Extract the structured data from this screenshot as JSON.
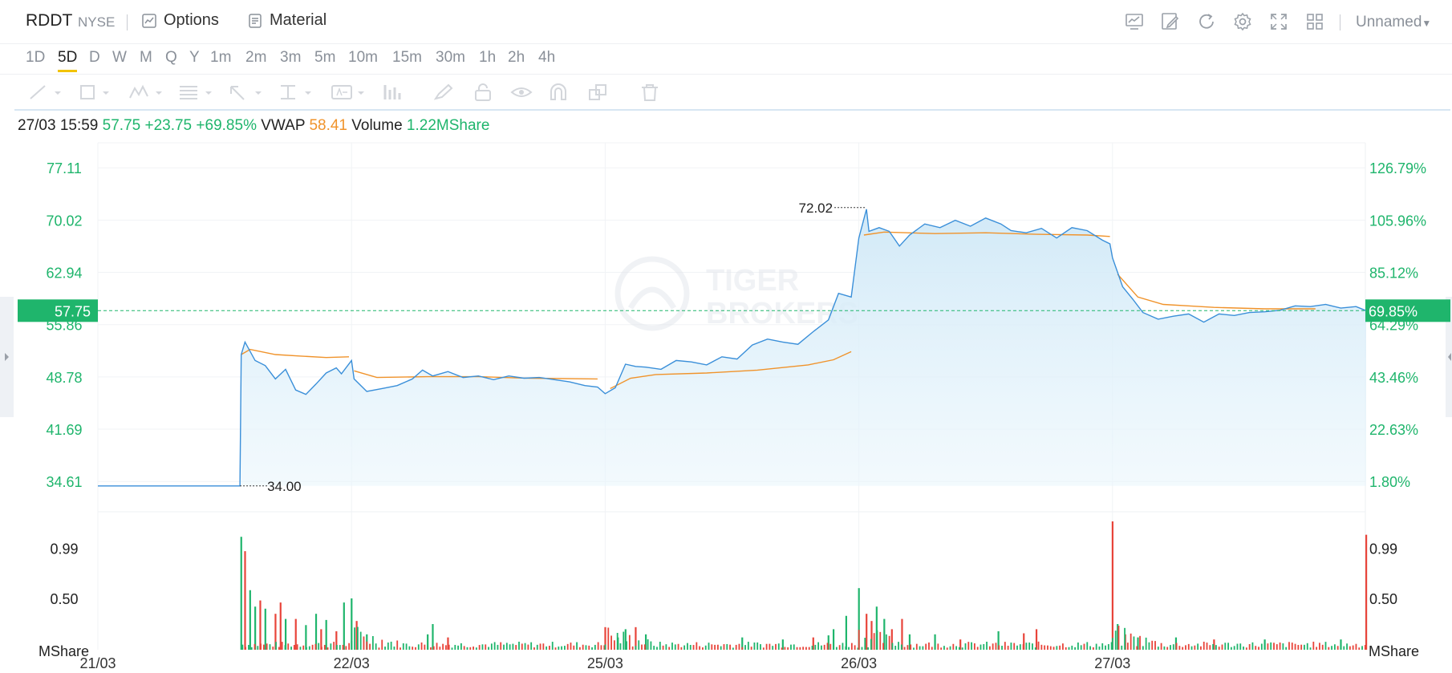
{
  "header": {
    "symbol": "RDDT",
    "exchange": "NYSE",
    "options_label": "Options",
    "material_label": "Material",
    "layout_name": "Unnamed"
  },
  "timeframes": [
    "1D",
    "5D",
    "D",
    "W",
    "M",
    "Q",
    "Y",
    "1m",
    "2m",
    "3m",
    "5m",
    "10m",
    "15m",
    "30m",
    "1h",
    "2h",
    "4h"
  ],
  "active_timeframe": "5D",
  "info": {
    "datetime": "27/03 15:59",
    "price": "57.75",
    "change": "+23.75",
    "change_pct": "+69.85%",
    "vwap_label": "VWAP",
    "vwap_value": "58.41",
    "volume_label": "Volume",
    "volume_value": "1.22MShare"
  },
  "watermark": {
    "line1": "TIGER",
    "line2": "BROKERS"
  },
  "colors": {
    "up": "#1fb56c",
    "down": "#e8443a",
    "price_line": "#3a8fd9",
    "vwap_line": "#f0932b",
    "accent": "#f2c300"
  },
  "chart_data": {
    "type": "line",
    "x_ticks": [
      "21/03",
      "22/03",
      "25/03",
      "26/03",
      "27/03"
    ],
    "left_axis": [
      "77.11",
      "70.02",
      "62.94",
      "55.86",
      "48.78",
      "41.69",
      "34.61"
    ],
    "right_axis": [
      "126.79%",
      "105.96%",
      "85.12%",
      "64.29%",
      "43.46%",
      "22.63%",
      "1.80%"
    ],
    "current_price_tag": "57.75",
    "current_pct_tag": "69.85%",
    "high_label": "72.02",
    "low_label": "34.00",
    "ylim": [
      30.5,
      80.5
    ],
    "prev_close": 34.0,
    "volume_axis": [
      "0.99",
      "0.50"
    ],
    "volume_unit": "MShare",
    "volume_ylim": [
      0,
      1.25
    ],
    "series": [
      {
        "name": "Price",
        "values": [
          [
            0,
            34.0
          ],
          [
            0.56,
            34.0
          ],
          [
            0.565,
            51.8
          ],
          [
            0.58,
            53.5
          ],
          [
            0.62,
            51.0
          ],
          [
            0.66,
            50.3
          ],
          [
            0.7,
            48.5
          ],
          [
            0.74,
            49.8
          ],
          [
            0.78,
            47.0
          ],
          [
            0.82,
            46.4
          ],
          [
            0.86,
            47.8
          ],
          [
            0.9,
            49.3
          ],
          [
            0.94,
            50.0
          ],
          [
            0.96,
            49.2
          ],
          [
            1.0,
            51.0
          ],
          [
            1.01,
            48.5
          ],
          [
            1.06,
            46.8
          ],
          [
            1.12,
            47.2
          ],
          [
            1.18,
            47.6
          ],
          [
            1.24,
            48.5
          ],
          [
            1.28,
            49.7
          ],
          [
            1.32,
            48.9
          ],
          [
            1.38,
            49.5
          ],
          [
            1.44,
            48.7
          ],
          [
            1.5,
            48.9
          ],
          [
            1.56,
            48.4
          ],
          [
            1.62,
            48.9
          ],
          [
            1.68,
            48.6
          ],
          [
            1.74,
            48.7
          ],
          [
            1.8,
            48.4
          ],
          [
            1.86,
            48.1
          ],
          [
            1.92,
            47.6
          ],
          [
            1.97,
            47.4
          ],
          [
            2.0,
            46.5
          ],
          [
            2.04,
            47.3
          ],
          [
            2.08,
            50.5
          ],
          [
            2.12,
            50.2
          ],
          [
            2.16,
            50.1
          ],
          [
            2.22,
            49.8
          ],
          [
            2.28,
            51.0
          ],
          [
            2.34,
            50.8
          ],
          [
            2.4,
            50.4
          ],
          [
            2.46,
            51.5
          ],
          [
            2.52,
            51.2
          ],
          [
            2.58,
            53.1
          ],
          [
            2.64,
            53.9
          ],
          [
            2.7,
            53.5
          ],
          [
            2.76,
            53.2
          ],
          [
            2.82,
            54.9
          ],
          [
            2.88,
            56.5
          ],
          [
            2.92,
            60.1
          ],
          [
            2.97,
            59.6
          ],
          [
            3.0,
            67.6
          ],
          [
            3.03,
            71.5
          ],
          [
            3.04,
            68.5
          ],
          [
            3.08,
            69.0
          ],
          [
            3.12,
            68.5
          ],
          [
            3.16,
            66.5
          ],
          [
            3.2,
            68.0
          ],
          [
            3.26,
            69.5
          ],
          [
            3.32,
            69.0
          ],
          [
            3.38,
            70.0
          ],
          [
            3.44,
            69.2
          ],
          [
            3.5,
            70.3
          ],
          [
            3.56,
            69.5
          ],
          [
            3.6,
            68.6
          ],
          [
            3.66,
            68.3
          ],
          [
            3.72,
            68.9
          ],
          [
            3.78,
            67.6
          ],
          [
            3.84,
            69.0
          ],
          [
            3.9,
            68.6
          ],
          [
            3.96,
            67.3
          ],
          [
            3.99,
            66.8
          ],
          [
            4.0,
            64.9
          ],
          [
            4.04,
            61.0
          ],
          [
            4.08,
            59.3
          ],
          [
            4.12,
            57.5
          ],
          [
            4.18,
            56.6
          ],
          [
            4.24,
            57.0
          ],
          [
            4.3,
            57.3
          ],
          [
            4.36,
            56.2
          ],
          [
            4.42,
            57.3
          ],
          [
            4.48,
            57.1
          ],
          [
            4.54,
            57.5
          ],
          [
            4.6,
            57.6
          ],
          [
            4.66,
            57.8
          ],
          [
            4.72,
            58.4
          ],
          [
            4.78,
            58.3
          ],
          [
            4.84,
            58.6
          ],
          [
            4.9,
            58.1
          ],
          [
            4.96,
            58.3
          ],
          [
            5.0,
            57.75
          ]
        ]
      },
      {
        "name": "VWAP",
        "values": [
          [
            0.565,
            51.8
          ],
          [
            0.6,
            52.5
          ],
          [
            0.7,
            51.8
          ],
          [
            0.8,
            51.6
          ],
          [
            0.9,
            51.4
          ],
          [
            0.99,
            51.5
          ],
          [
            1.01,
            49.6
          ],
          [
            1.1,
            48.7
          ],
          [
            1.3,
            48.8
          ],
          [
            1.5,
            48.8
          ],
          [
            1.7,
            48.6
          ],
          [
            1.97,
            48.5
          ],
          [
            2.02,
            47.2
          ],
          [
            2.1,
            48.6
          ],
          [
            2.2,
            49.1
          ],
          [
            2.4,
            49.3
          ],
          [
            2.6,
            49.7
          ],
          [
            2.8,
            50.4
          ],
          [
            2.9,
            51.1
          ],
          [
            2.97,
            52.2
          ],
          [
            3.02,
            68.0
          ],
          [
            3.1,
            68.4
          ],
          [
            3.3,
            68.2
          ],
          [
            3.5,
            68.3
          ],
          [
            3.7,
            68.1
          ],
          [
            3.9,
            68.0
          ],
          [
            3.99,
            67.8
          ],
          [
            4.02,
            62.7
          ],
          [
            4.1,
            59.6
          ],
          [
            4.2,
            58.6
          ],
          [
            4.4,
            58.2
          ],
          [
            4.6,
            58.0
          ],
          [
            4.8,
            58.0
          ],
          [
            5.0,
            58.2
          ]
        ]
      }
    ],
    "volume_spikes": [
      {
        "x": 0.565,
        "v": 1.1,
        "dir": "up"
      },
      {
        "x": 0.58,
        "v": 0.96,
        "dir": "down"
      },
      {
        "x": 0.6,
        "v": 0.58,
        "dir": "up"
      },
      {
        "x": 0.62,
        "v": 0.42,
        "dir": "up"
      },
      {
        "x": 0.64,
        "v": 0.48,
        "dir": "down"
      },
      {
        "x": 0.66,
        "v": 0.4,
        "dir": "up"
      },
      {
        "x": 0.7,
        "v": 0.35,
        "dir": "down"
      },
      {
        "x": 0.72,
        "v": 0.46,
        "dir": "down"
      },
      {
        "x": 0.74,
        "v": 0.3,
        "dir": "up"
      },
      {
        "x": 0.78,
        "v": 0.3,
        "dir": "down"
      },
      {
        "x": 0.82,
        "v": 0.24,
        "dir": "up"
      },
      {
        "x": 0.86,
        "v": 0.35,
        "dir": "up"
      },
      {
        "x": 0.88,
        "v": 0.2,
        "dir": "down"
      },
      {
        "x": 0.9,
        "v": 0.29,
        "dir": "up"
      },
      {
        "x": 0.94,
        "v": 0.18,
        "dir": "down"
      },
      {
        "x": 0.97,
        "v": 0.46,
        "dir": "up"
      },
      {
        "x": 1.0,
        "v": 0.5,
        "dir": "up"
      },
      {
        "x": 1.02,
        "v": 0.28,
        "dir": "down"
      },
      {
        "x": 1.06,
        "v": 0.15,
        "dir": "up"
      },
      {
        "x": 1.3,
        "v": 0.15,
        "dir": "up"
      },
      {
        "x": 1.32,
        "v": 0.25,
        "dir": "up"
      },
      {
        "x": 1.38,
        "v": 0.12,
        "dir": "down"
      },
      {
        "x": 2.0,
        "v": 0.22,
        "dir": "down"
      },
      {
        "x": 2.05,
        "v": 0.12,
        "dir": "up"
      },
      {
        "x": 2.08,
        "v": 0.2,
        "dir": "up"
      },
      {
        "x": 2.12,
        "v": 0.22,
        "dir": "down"
      },
      {
        "x": 2.16,
        "v": 0.15,
        "dir": "up"
      },
      {
        "x": 2.54,
        "v": 0.12,
        "dir": "up"
      },
      {
        "x": 2.7,
        "v": 0.1,
        "dir": "up"
      },
      {
        "x": 2.82,
        "v": 0.12,
        "dir": "down"
      },
      {
        "x": 2.88,
        "v": 0.14,
        "dir": "up"
      },
      {
        "x": 2.9,
        "v": 0.2,
        "dir": "up"
      },
      {
        "x": 2.95,
        "v": 0.33,
        "dir": "up"
      },
      {
        "x": 3.0,
        "v": 0.6,
        "dir": "up"
      },
      {
        "x": 3.03,
        "v": 0.35,
        "dir": "down"
      },
      {
        "x": 3.05,
        "v": 0.28,
        "dir": "down"
      },
      {
        "x": 3.07,
        "v": 0.42,
        "dir": "up"
      },
      {
        "x": 3.1,
        "v": 0.3,
        "dir": "up"
      },
      {
        "x": 3.13,
        "v": 0.2,
        "dir": "down"
      },
      {
        "x": 3.17,
        "v": 0.3,
        "dir": "down"
      },
      {
        "x": 3.2,
        "v": 0.15,
        "dir": "up"
      },
      {
        "x": 3.3,
        "v": 0.15,
        "dir": "up"
      },
      {
        "x": 3.4,
        "v": 0.1,
        "dir": "down"
      },
      {
        "x": 3.55,
        "v": 0.18,
        "dir": "up"
      },
      {
        "x": 3.65,
        "v": 0.16,
        "dir": "down"
      },
      {
        "x": 3.7,
        "v": 0.2,
        "dir": "down"
      },
      {
        "x": 4.0,
        "v": 1.25,
        "dir": "down"
      },
      {
        "x": 4.02,
        "v": 0.25,
        "dir": "up"
      },
      {
        "x": 4.05,
        "v": 0.15,
        "dir": "down"
      },
      {
        "x": 4.1,
        "v": 0.12,
        "dir": "up"
      },
      {
        "x": 4.25,
        "v": 0.12,
        "dir": "up"
      },
      {
        "x": 4.4,
        "v": 0.1,
        "dir": "down"
      },
      {
        "x": 4.6,
        "v": 0.1,
        "dir": "up"
      },
      {
        "x": 4.9,
        "v": 0.1,
        "dir": "up"
      },
      {
        "x": 5.0,
        "v": 1.12,
        "dir": "down"
      }
    ]
  }
}
